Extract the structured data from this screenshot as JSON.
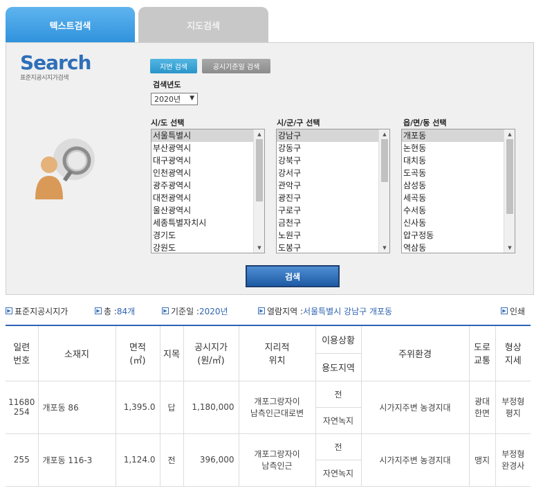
{
  "tabs": [
    {
      "label": "텍스트검색",
      "active": true
    },
    {
      "label": "지도검색",
      "active": false
    }
  ],
  "logo": {
    "word": "Search",
    "subtitle": "표준지공시지가검색"
  },
  "mode_buttons": {
    "lot": "지번 검색",
    "date": "공시기준일 검색"
  },
  "year": {
    "label": "검색년도",
    "value": "2020년"
  },
  "sido": {
    "label": "시/도 선택",
    "options": [
      "서울특별시",
      "부산광역시",
      "대구광역시",
      "인천광역시",
      "광주광역시",
      "대전광역시",
      "울산광역시",
      "세종특별자치시",
      "경기도",
      "강원도"
    ],
    "selected": "서울특별시"
  },
  "sigungu": {
    "label": "시/군/구 선택",
    "options": [
      "강남구",
      "강동구",
      "강북구",
      "강서구",
      "관악구",
      "광진구",
      "구로구",
      "금천구",
      "노원구",
      "도봉구"
    ],
    "selected": "강남구"
  },
  "dong": {
    "label": "읍/면/동 선택",
    "options": [
      "개포동",
      "논현동",
      "대치동",
      "도곡동",
      "삼성동",
      "세곡동",
      "수서동",
      "신사동",
      "압구정동",
      "역삼동"
    ],
    "selected": "개포동"
  },
  "search_button": "검색",
  "info": {
    "title": "표준지공시지가",
    "total_label": "총 : ",
    "total_value": "84개",
    "base_label": "기준일 : ",
    "base_value": "2020년",
    "region_label": "열람지역 : ",
    "region_value": "서울특별시 강남구 개포동",
    "print": "인쇄"
  },
  "table": {
    "headers": {
      "serial": "일련\n번호",
      "location": "소재지",
      "area": "면적\n(㎡)",
      "category": "지목",
      "price": "공시지가\n(원/㎡)",
      "geo": "지리적\n위치",
      "usage_status": "이용상황",
      "zoning": "용도지역",
      "environment": "주위환경",
      "road": "도로\n교통",
      "shape": "형상\n지세"
    },
    "rows": [
      {
        "serial": "11680\n254",
        "location": "개포동 86",
        "area": "1,395.0",
        "category": "답",
        "price": "1,180,000",
        "geo": "개포그랑자이\n남측인근대로변",
        "usage_status": "전",
        "zoning": "자연녹지",
        "environment": "시가지주변 농경지대",
        "road": "광대\n한면",
        "shape": "부정형\n평지"
      },
      {
        "serial": "255",
        "location": "개포동 116-3",
        "area": "1,124.0",
        "category": "전",
        "price": "396,000",
        "geo": "개포그랑자이\n남측인근",
        "usage_status": "전",
        "zoning": "자연녹지",
        "environment": "시가지주변 농경지대",
        "road": "맹지",
        "shape": "부정형\n완경사"
      }
    ]
  }
}
